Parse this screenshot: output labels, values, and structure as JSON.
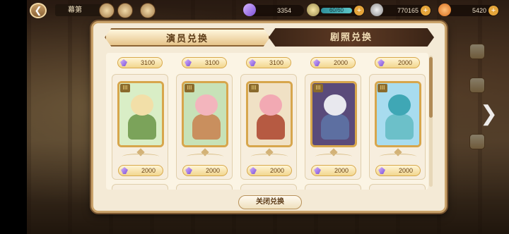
{
  "hud": {
    "title": "幕第",
    "currency_1": "3354",
    "currency_2_bar": "60/60",
    "currency_3": "770165",
    "currency_4": "5420"
  },
  "modal": {
    "tabs": [
      {
        "label": "演员兑换",
        "active": true
      },
      {
        "label": "剧照兑换",
        "active": false
      }
    ],
    "top_prices": [
      "3100",
      "3100",
      "3100",
      "2000",
      "2000"
    ],
    "cards": [
      {
        "rank": "III",
        "price": "2000",
        "colors": {
          "bg": "#d9eec6",
          "hair": "#f2dfa8",
          "body": "#7ba35a"
        }
      },
      {
        "rank": "III",
        "price": "2000",
        "colors": {
          "bg": "#c7e2b8",
          "hair": "#f3b5bd",
          "body": "#c98f5e"
        }
      },
      {
        "rank": "III",
        "price": "2000",
        "colors": {
          "bg": "#f0e1c5",
          "hair": "#f2a9b3",
          "body": "#b65a42"
        }
      },
      {
        "rank": "III",
        "price": "2000",
        "colors": {
          "bg": "#5a4a7a",
          "hair": "#e8e8ee",
          "body": "#5d6fa1"
        }
      },
      {
        "rank": "III",
        "price": "2000",
        "colors": {
          "bg": "#a8dcef",
          "hair": "#3fa7b5",
          "body": "#6cc0c9"
        }
      }
    ],
    "close_label": "关闭兑换"
  },
  "colors": {
    "accent": "#caa36b",
    "tab_active": "#e6c48a",
    "tab_inactive": "#3a2416",
    "price_gem": "#7d52d6"
  }
}
